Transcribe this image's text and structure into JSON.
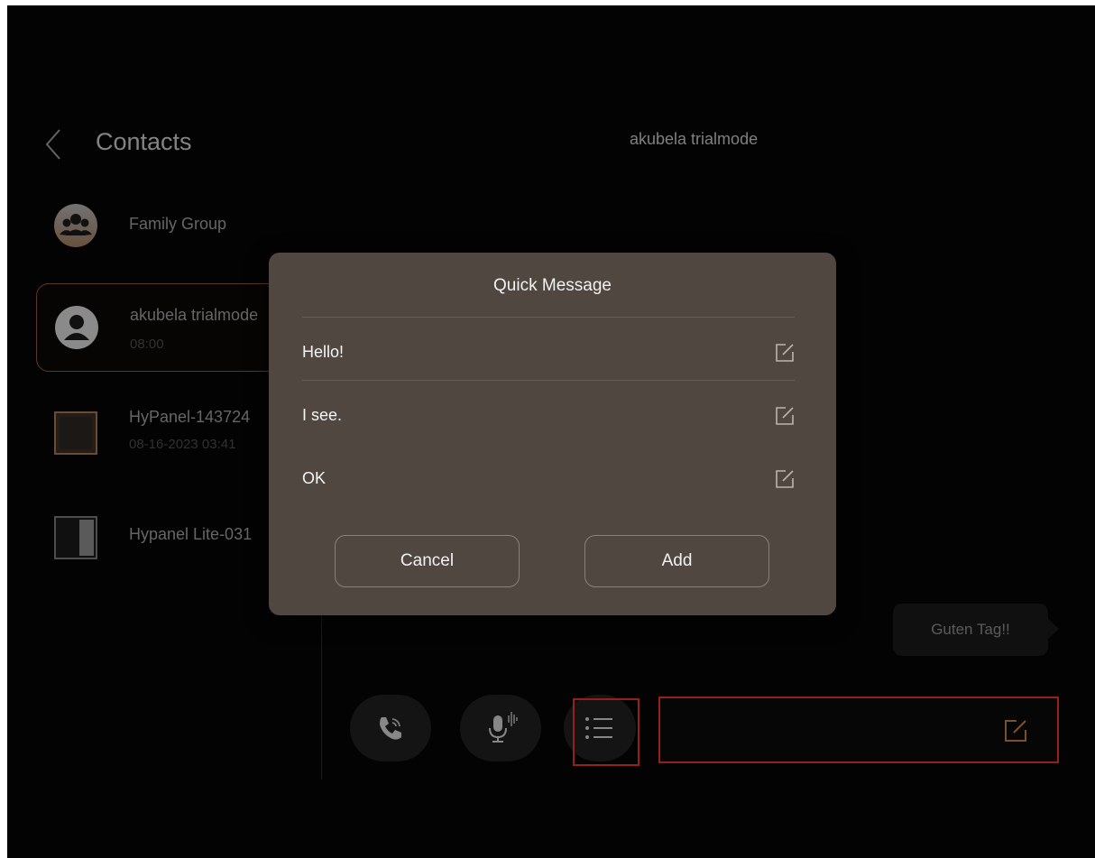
{
  "header": {
    "back_icon": "chevron-left-icon",
    "contacts_title": "Contacts",
    "chat_title": "akubela trialmode"
  },
  "contacts": [
    {
      "name": "Family Group",
      "time": "",
      "avatar": "group-avatar-icon"
    },
    {
      "name": "akubela trialmode",
      "time": "08:00",
      "avatar": "user-avatar-icon",
      "selected": true
    },
    {
      "name": "HyPanel-143724",
      "time": "08-16-2023 03:41",
      "avatar": "panel-device-icon"
    },
    {
      "name": "Hypanel Lite-031",
      "time": "",
      "avatar": "panel-lite-device-icon"
    }
  ],
  "chat": {
    "bubble_text": "Guten Tag!!"
  },
  "controls": {
    "call_icon": "phone-call-icon",
    "voice_icon": "microphone-icon",
    "quick_list_icon": "list-icon",
    "input_edit_icon": "edit-icon"
  },
  "modal": {
    "title": "Quick Message",
    "items": [
      {
        "text": "Hello!"
      },
      {
        "text": "I see."
      },
      {
        "text": "OK"
      }
    ],
    "cancel_label": "Cancel",
    "add_label": "Add"
  },
  "colors": {
    "accent": "#c07a45",
    "highlight": "#e53324",
    "modal_bg": "#504840",
    "screen_bg": "#050505"
  }
}
